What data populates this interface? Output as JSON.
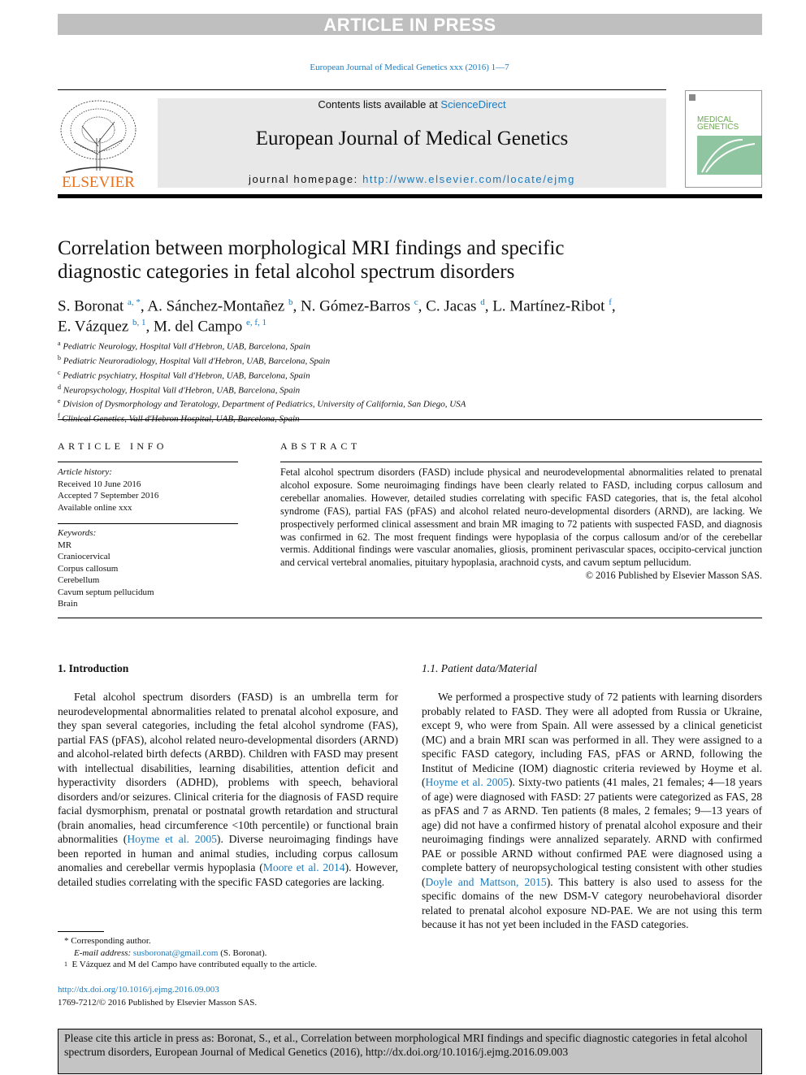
{
  "banner": {
    "article_in_press": "ARTICLE IN PRESS",
    "journal_ref": "European Journal of Medical Genetics xxx (2016) 1—7",
    "contents_prefix": "Contents lists available at ",
    "sciencedirect": "ScienceDirect",
    "journal_title": "European Journal of Medical Genetics",
    "homepage_prefix": "journal homepage: ",
    "homepage_url": "http://www.elsevier.com/locate/ejmg",
    "publisher_logo": "ELSEVIER",
    "cover_text": "MEDICAL GENETICS"
  },
  "title_lines": [
    "Correlation between morphological MRI findings and specific",
    "diagnostic categories in fetal alcohol spectrum disorders"
  ],
  "authors": [
    {
      "name": "S. Boronat",
      "sup": "a, *",
      "sep": ", "
    },
    {
      "name": "A. Sánchez-Montañez",
      "sup": "b",
      "sep": ", "
    },
    {
      "name": "N. Gómez-Barros",
      "sup": "c",
      "sep": ", "
    },
    {
      "name": "C. Jacas",
      "sup": "d",
      "sep": ", "
    },
    {
      "name": "L. Martínez-Ribot",
      "sup": "f",
      "sep": ","
    },
    {
      "name": "E. Vázquez",
      "sup": "b, 1",
      "sep": ", "
    },
    {
      "name": "M. del Campo",
      "sup": "e, f, 1",
      "sep": ""
    }
  ],
  "affiliations": [
    {
      "key": "a",
      "text": "Pediatric Neurology, Hospital Vall d'Hebron, UAB, Barcelona, Spain"
    },
    {
      "key": "b",
      "text": "Pediatric Neuroradiology, Hospital Vall d'Hebron, UAB, Barcelona, Spain"
    },
    {
      "key": "c",
      "text": "Pediatric psychiatry, Hospital Vall d'Hebron, UAB, Barcelona, Spain"
    },
    {
      "key": "d",
      "text": "Neuropsychology, Hospital Vall d'Hebron, UAB, Barcelona, Spain"
    },
    {
      "key": "e",
      "text": "Division of Dysmorphology and Teratology, Department of Pediatrics, University of California, San Diego, USA"
    },
    {
      "key": "f",
      "text": "Clinical Genetics, Vall d'Hebron Hospital, UAB, Barcelona, Spain"
    }
  ],
  "article_info": {
    "heading": "ARTICLE INFO",
    "history_label": "Article history:",
    "received": "Received 10 June 2016",
    "accepted": "Accepted 7 September 2016",
    "online": "Available online xxx",
    "keywords_label": "Keywords:",
    "keywords": [
      "MR",
      "Craniocervical",
      "Corpus callosum",
      "Cerebellum",
      "Cavum septum pellucidum",
      "Brain"
    ]
  },
  "abstract": {
    "heading": "ABSTRACT",
    "text": "Fetal alcohol spectrum disorders (FASD) include physical and neurodevelopmental abnormalities related to prenatal alcohol exposure. Some neuroimaging findings have been clearly related to FASD, including corpus callosum and cerebellar anomalies. However, detailed studies correlating with specific FASD categories, that is, the fetal alcohol syndrome (FAS), partial FAS (pFAS) and alcohol related neuro-developmental disorders (ARND), are lacking. We prospectively performed clinical assessment and brain MR imaging to 72 patients with suspected FASD, and diagnosis was confirmed in 62. The most frequent findings were hypoplasia of the corpus callosum and/or of the cerebellar vermis. Additional findings were vascular anomalies, gliosis, prominent perivascular spaces, occipito-cervical junction and cervical vertebral anomalies, pituitary hypoplasia, arachnoid cysts, and cavum septum pellucidum.",
    "copyright": "© 2016 Published by Elsevier Masson SAS."
  },
  "intro": {
    "heading": "1.  Introduction",
    "p1": "Fetal alcohol spectrum disorders (FASD) is an umbrella term for neurodevelopmental abnormalities related to prenatal alcohol exposure, and they span several categories, including the fetal alcohol syndrome (FAS), partial FAS (pFAS), alcohol related neuro-developmental disorders (ARND) and alcohol-related birth defects (ARBD). Children with FASD may present with intellectual disabilities, learning disabilities, attention deficit and hyperactivity disorders (ADHD), problems with speech, behavioral disorders and/or seizures. Clinical criteria for the diagnosis of FASD require facial dysmorphism, prenatal or postnatal growth retardation and structural (brain anomalies, head circumference <10th percentile) or functional brain abnormalities (",
    "ref1": "Hoyme et al. 2005",
    "p2": "). Diverse neuroimaging findings have been reported in human and animal studies, including corpus callosum anomalies and cerebellar vermis hypoplasia (",
    "ref2": "Moore et al. 2014",
    "p3": "). However, detailed studies correlating with the specific FASD categories are lacking."
  },
  "patient_data": {
    "heading": "1.1.  Patient data/Material",
    "p1": "We performed a prospective study of 72 patients with learning disorders probably related to FASD. They were all adopted from Russia or Ukraine, except 9, who were from Spain. All were assessed by a clinical geneticist (MC) and a brain MRI scan was performed in all. They were assigned to a specific FASD category, including FAS, pFAS or ARND, following the Institut of Medicine (IOM) diagnostic criteria reviewed by Hoyme et al. (",
    "ref1": "Hoyme et al. 2005",
    "p2": "). Sixty-two patients (41 males, 21 females; 4—18 years of age) were diagnosed with FASD: 27 patients were categorized as FAS, 28 as pFAS and 7 as ARND. Ten patients (8 males, 2 females; 9—13 years of age) did not have a confirmed history of prenatal alcohol exposure and their neuroimaging findings were annalized separately. ARND with confirmed PAE or possible ARND without confirmed PAE were diagnosed using a complete battery of neuropsychological testing consistent with other studies (",
    "ref2": "Doyle and Mattson, 2015",
    "p3": "). This battery is also used to assess for the specific domains of the new DSM-V category neurobehavioral disorder related to prenatal alcohol exposure ND-PAE. We are not using this term because it has not yet been included in the FASD categories."
  },
  "footnotes": {
    "star": "*",
    "corresponding": "Corresponding author.",
    "email_label": "E-mail address: ",
    "email": "susboronat@gmail.com",
    "email_owner": " (S. Boronat).",
    "one": "1",
    "equal": "E Vázquez and M del Campo have contributed equally to the article."
  },
  "doi": {
    "url": "http://dx.doi.org/10.1016/j.ejmg.2016.09.003",
    "issn": "1769-7212/© 2016 Published by Elsevier Masson SAS."
  },
  "cite": "Please cite this article in press as: Boronat, S., et al., Correlation between morphological MRI findings and specific diagnostic categories in fetal alcohol spectrum disorders, European Journal of Medical Genetics (2016), http://dx.doi.org/10.1016/j.ejmg.2016.09.003",
  "colors": {
    "link": "#1a7bbf",
    "publisher": "#e9711c",
    "banner_bg": "#e8e8e8",
    "cite_bg": "#c4c4c4"
  }
}
